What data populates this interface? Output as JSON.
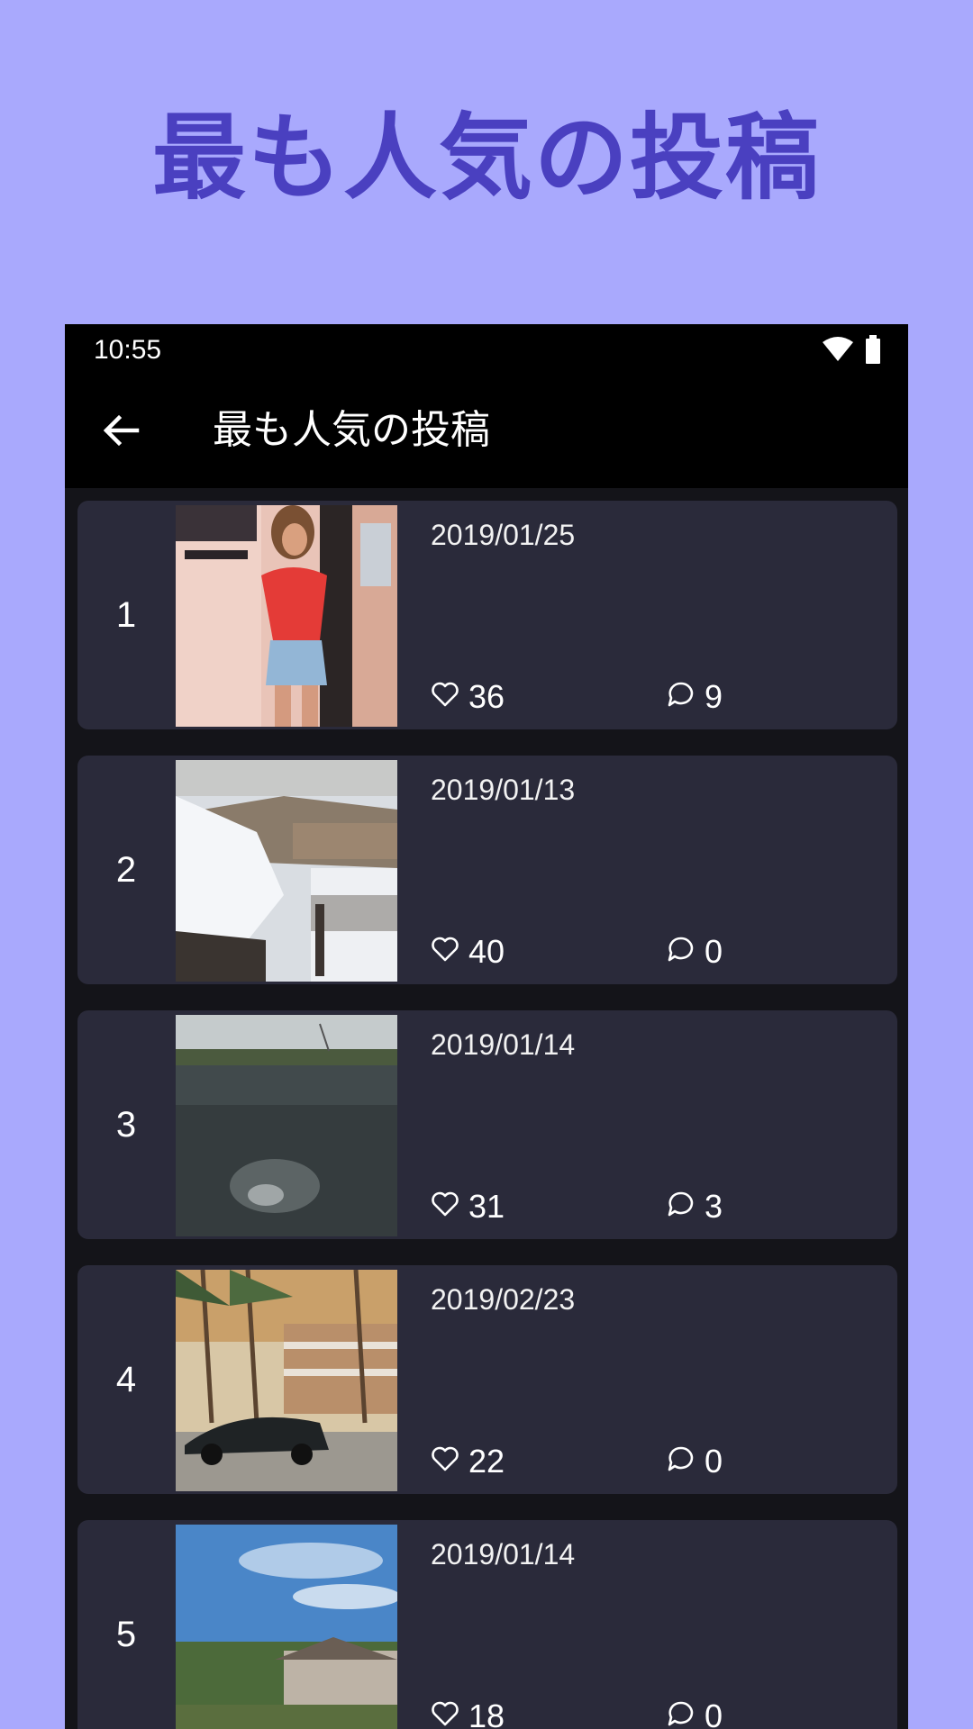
{
  "promo": {
    "title": "最も人気の投稿",
    "background_color": "#a9a9fd",
    "title_color": "#4a40c0"
  },
  "status_bar": {
    "time": "10:55",
    "icons": [
      "wifi-icon",
      "battery-icon"
    ]
  },
  "app_bar": {
    "back_icon": "arrow-left-icon",
    "title": "最も人気の投稿"
  },
  "colors": {
    "screen_bg": "#141419",
    "card_bg": "#2a2a3a",
    "text": "#ffffff"
  },
  "posts": [
    {
      "rank": "1",
      "date": "2019/01/25",
      "likes": "36",
      "comments": "9",
      "thumbnail": "woman-red-tshirt-photo"
    },
    {
      "rank": "2",
      "date": "2019/01/13",
      "likes": "40",
      "comments": "0",
      "thumbnail": "snowy-village-photo"
    },
    {
      "rank": "3",
      "date": "2019/01/14",
      "likes": "31",
      "comments": "3",
      "thumbnail": "lake-water-photo"
    },
    {
      "rank": "4",
      "date": "2019/02/23",
      "likes": "22",
      "comments": "0",
      "thumbnail": "palm-trees-car-photo"
    },
    {
      "rank": "5",
      "date": "2019/01/14",
      "likes": "18",
      "comments": "0",
      "thumbnail": "blue-sky-village-photo"
    }
  ]
}
